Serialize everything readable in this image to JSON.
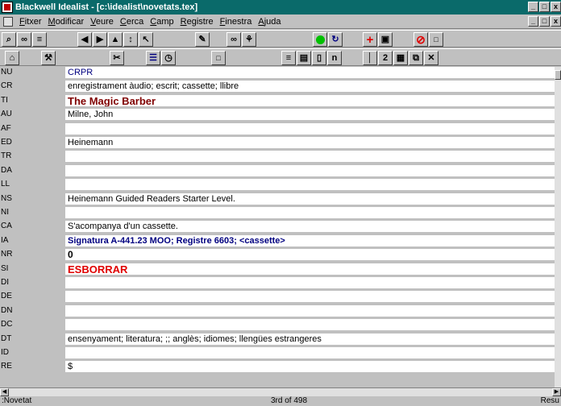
{
  "window": {
    "title": "Blackwell Idealist - [c:\\idealist\\novetats.tex]",
    "minimize": "_",
    "restore": "□",
    "close": "x"
  },
  "menu": [
    "Fitxer",
    "Modificar",
    "Veure",
    "Cerca",
    "Camp",
    "Registre",
    "Finestra",
    "Ajuda"
  ],
  "mdi": {
    "minimize": "_",
    "restore": "□",
    "close": "x"
  },
  "toolbar1": {
    "search": "⌕",
    "binoculars": "∞",
    "list": "≡",
    "first": "◀",
    "next": "▶",
    "up": "▲",
    "updown": "↕",
    "cursor": "↖",
    "pen": "✎",
    "link": "∞",
    "shield": "⚘",
    "refresh": "↻",
    "camera": "▣",
    "stop_inner": "□"
  },
  "toolbar2": {
    "home": "⌂",
    "tools": "⚒",
    "scissors": "✂",
    "form": "☰",
    "clock": "◷",
    "small_box": "□",
    "lines": "≡",
    "note": "▤",
    "page": "▯",
    "n": "n",
    "thermo": "│",
    "two": "2",
    "stack": "▦",
    "copy": "⧉",
    "cross": "✕"
  },
  "record": [
    {
      "code": "NU",
      "value": "CRPR",
      "style": "blue"
    },
    {
      "code": "CR",
      "value": "enregistrament àudio; escrit; cassette; llibre",
      "style": ""
    },
    {
      "code": "TI",
      "value": "The Magic Barber",
      "style": "title"
    },
    {
      "code": "AU",
      "value": "Milne, John",
      "style": ""
    },
    {
      "code": "AF",
      "value": "",
      "style": ""
    },
    {
      "code": "ED",
      "value": "Heinemann",
      "style": ""
    },
    {
      "code": "TR",
      "value": "",
      "style": ""
    },
    {
      "code": "DA",
      "value": "",
      "style": ""
    },
    {
      "code": "LL",
      "value": "",
      "style": ""
    },
    {
      "code": "NS",
      "value": "Heinemann Guided Readers Starter Level.",
      "style": ""
    },
    {
      "code": "NI",
      "value": "",
      "style": ""
    },
    {
      "code": "CA",
      "value": "S'acompanya d'un cassette.",
      "style": ""
    },
    {
      "code": "IA",
      "value": "Signatura A-441.23 MOO; Registre 6603; <cassette>",
      "style": "signatura"
    },
    {
      "code": "NR",
      "value": "0",
      "style": "bold"
    },
    {
      "code": "SI",
      "value": "ESBORRAR",
      "style": "red"
    },
    {
      "code": "DI",
      "value": "",
      "style": ""
    },
    {
      "code": "DE",
      "value": "",
      "style": ""
    },
    {
      "code": "DN",
      "value": "",
      "style": ""
    },
    {
      "code": "DC",
      "value": "",
      "style": ""
    },
    {
      "code": "DT",
      "value": "ensenyament; literatura; ;; anglès; idiomes; llengües estrangeres",
      "style": ""
    },
    {
      "code": "ID",
      "value": "",
      "style": ""
    },
    {
      "code": "RE",
      "value": "$",
      "style": ""
    }
  ],
  "status": {
    "left": ":Novetat",
    "center": "3rd of 498",
    "right": "Resu"
  },
  "colors": {
    "titlebar": "#0a6a6a",
    "title_field": "#800000",
    "signatura": "#000080",
    "alert": "#e00000"
  }
}
